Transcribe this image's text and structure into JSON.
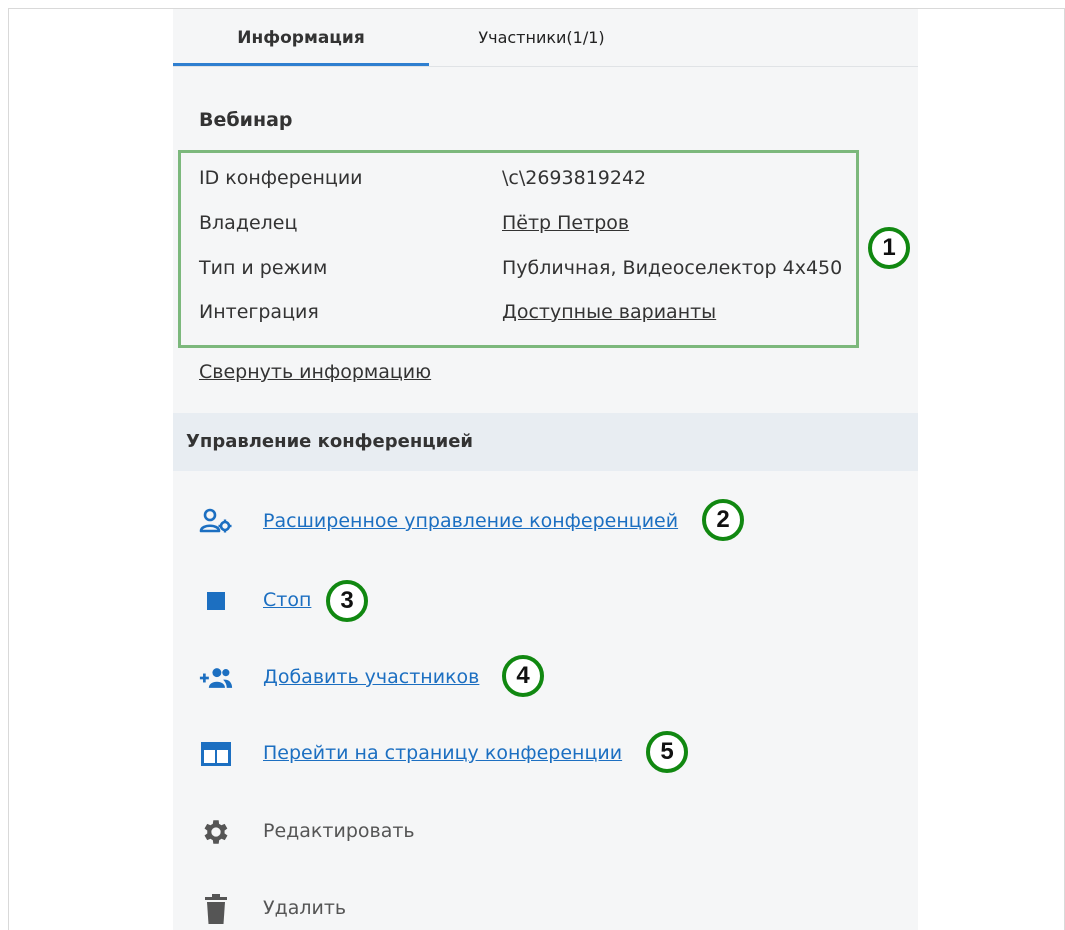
{
  "tabs": [
    {
      "label": "Информация"
    },
    {
      "label": "Участники(1/1)"
    }
  ],
  "section_title": "Вебинар",
  "info_rows": [
    {
      "label": "ID конференции",
      "value": "\\c\\2693819242"
    },
    {
      "label": "Владелец",
      "value": "Пётр Петров"
    },
    {
      "label": "Тип и режим",
      "value": "Публичная, Видеоселектор 4x450"
    },
    {
      "label": "Интеграция",
      "value": "Доступные варианты"
    }
  ],
  "collapse_label": "Свернуть информацию",
  "management_title": "Управление конференцией",
  "actions": [
    {
      "label": "Расширенное управление конференцией",
      "icon": "user-gear-icon"
    },
    {
      "label": "Стоп",
      "icon": "stop-icon"
    },
    {
      "label": "Добавить участников",
      "icon": "add-users-icon"
    },
    {
      "label": "Перейти на страницу конференции",
      "icon": "browser-window-icon"
    },
    {
      "label": "Редактировать",
      "icon": "gear-icon"
    },
    {
      "label": "Удалить",
      "icon": "trash-icon"
    }
  ],
  "badges": [
    "1",
    "2",
    "3",
    "4",
    "5"
  ],
  "colors": {
    "accent": "#2f7fd0",
    "link": "#1c6fc1",
    "callout": "#118811",
    "highlight_box": "#7cb87c"
  }
}
